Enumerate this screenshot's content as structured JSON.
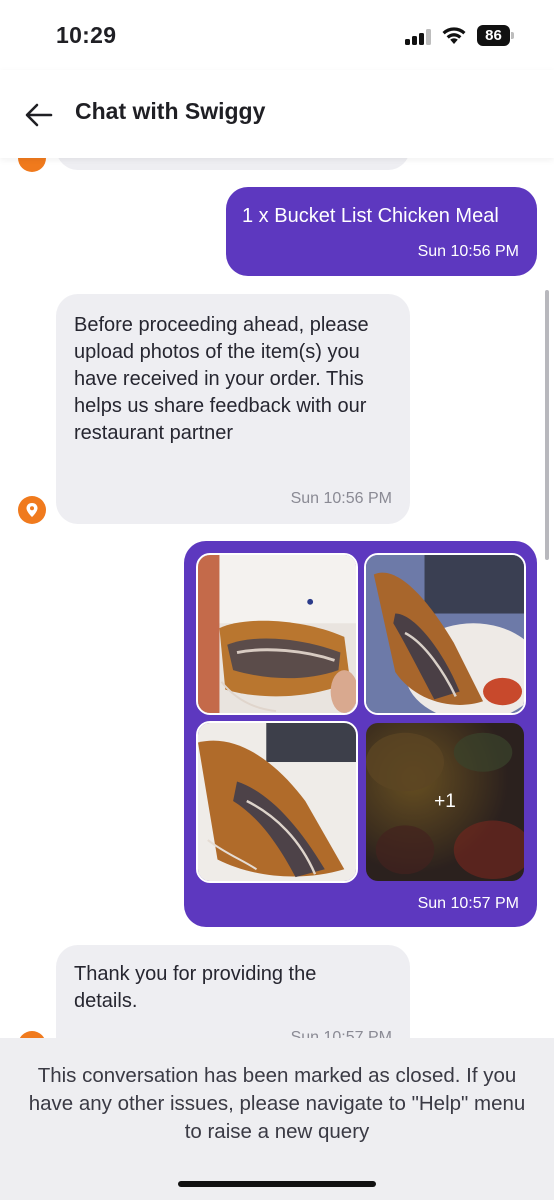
{
  "status_bar": {
    "time": "10:29",
    "battery": "86"
  },
  "header": {
    "title": "Chat with Swiggy",
    "back_icon": "arrow-left-icon"
  },
  "messages": [
    {
      "side": "outgoing",
      "text": "1 x Bucket List Chicken Meal",
      "time": "Sun 10:56 PM"
    },
    {
      "side": "incoming",
      "text": "Before proceeding ahead, please upload photos of the item(s) you have received in your order. This helps us share feedback with our restaurant partner",
      "time": "Sun 10:56 PM"
    },
    {
      "side": "outgoing",
      "type": "photos",
      "more_label": "+1",
      "time": "Sun 10:57 PM"
    },
    {
      "side": "incoming",
      "text": "Thank you for providing the details.",
      "time": "Sun 10:57 PM"
    }
  ],
  "footer": {
    "closed_text": "This conversation has been marked as closed. If you have any other issues, please navigate to \"Help\" menu to raise a new query"
  },
  "colors": {
    "outgoing_bubble": "#5d38bf",
    "incoming_bubble": "#eeeef2",
    "agent_avatar": "#f07a1d",
    "footer_bg": "#eeeef1"
  }
}
